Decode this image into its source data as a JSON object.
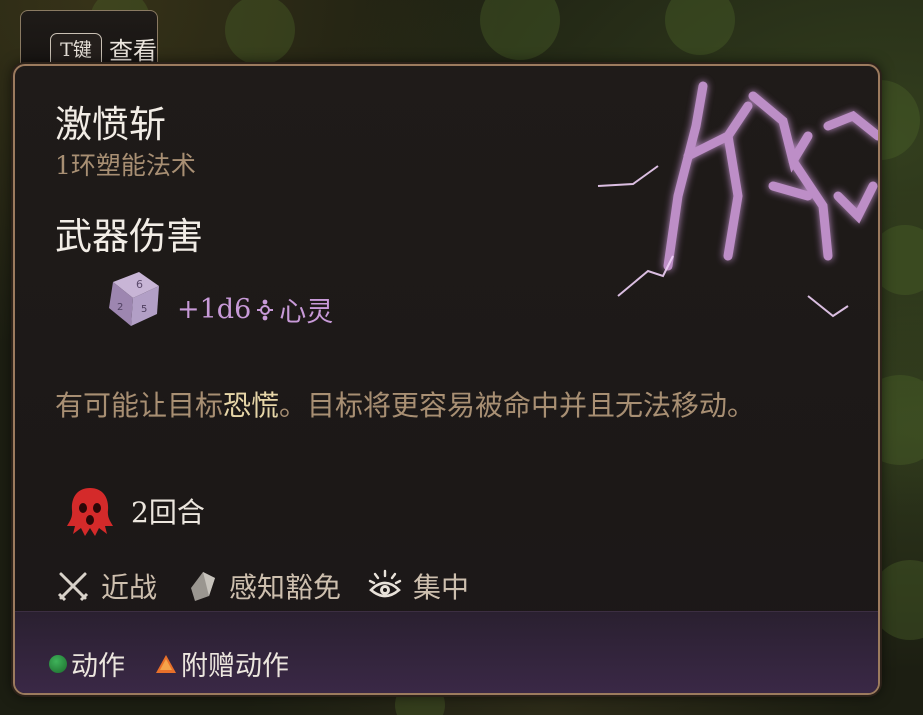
{
  "hotkey": {
    "key": "T键",
    "label": "查看"
  },
  "spell": {
    "name": "激愤斩",
    "level_school": "1环塑能法术",
    "section_title": "武器伤害",
    "damage": {
      "dice": "+1d6",
      "type": "心灵",
      "dice_icon": "d6-die-icon",
      "type_icon": "psychic-icon",
      "color": "#c89ad8"
    },
    "description": {
      "before": "有可能让目标",
      "keyword": "恐慌",
      "after": "。目标将更容易被命中并且无法移动。"
    },
    "condition": {
      "icon": "frightened-icon",
      "duration": "2回合",
      "color": "#d42a2a"
    },
    "properties": [
      {
        "icon": "crossed-swords-icon",
        "label": "近战"
      },
      {
        "icon": "shield-icon",
        "label": "感知豁免"
      },
      {
        "icon": "concentration-eye-icon",
        "label": "集中"
      }
    ],
    "costs": [
      {
        "icon": "action-dot-icon",
        "label": "动作",
        "color": "#2f9a48"
      },
      {
        "icon": "bonus-action-triangle-icon",
        "label": "附赠动作",
        "color": "#e8702a"
      }
    ]
  },
  "colors": {
    "frame": "#9c7b5e",
    "accent_muted": "#a88f73",
    "footer": "#3a2846"
  }
}
